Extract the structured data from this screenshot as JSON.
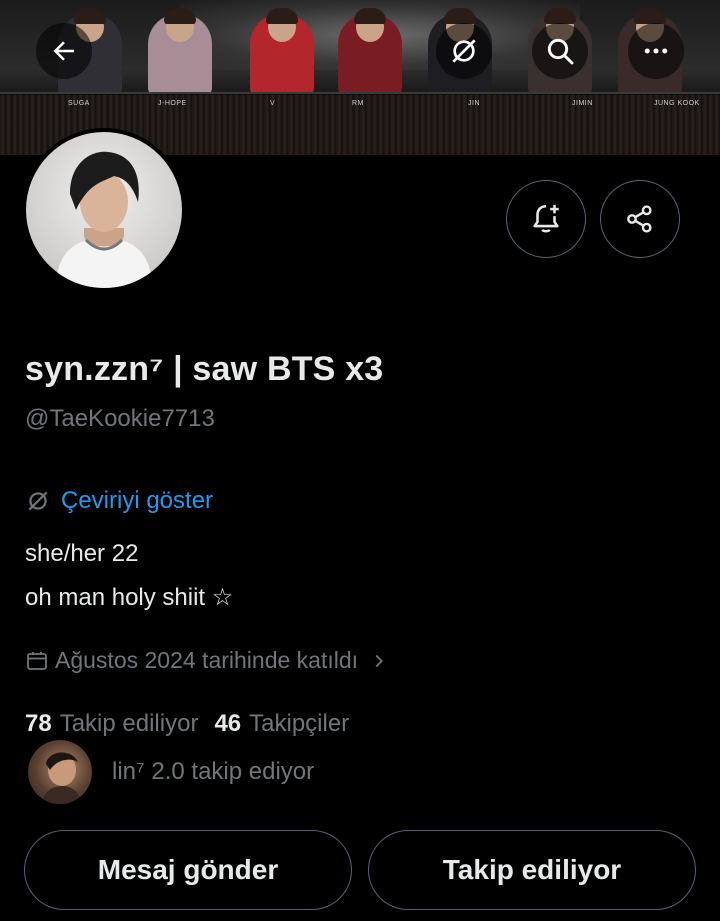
{
  "banner": {
    "name_tags": [
      "SUGA",
      "J-HOPE",
      "V",
      "RM",
      "JIN",
      "JIMIN",
      "JUNG KOOK"
    ]
  },
  "icons": {
    "back": "arrow-left-icon",
    "translate": "translate-icon",
    "search": "search-icon",
    "more": "more-horizontal-icon",
    "notify": "bell-plus-icon",
    "share": "share-icon",
    "calendar": "calendar-icon",
    "chevron": "chevron-right-icon"
  },
  "profile": {
    "display_name": "syn.zzn⁷ | saw BTS x3",
    "handle": "@TaeKookie7713",
    "translate_label": "Çeviriyi göster",
    "bio_lines": [
      "she/her 22",
      "oh man holy shiit ☆"
    ],
    "joined": "Ağustos 2024 tarihinde katıldı",
    "following_count": "78",
    "following_label": "Takip ediliyor",
    "followers_count": "46",
    "followers_label": "Takipçiler",
    "followed_by": "lin⁷ 2.0 takip ediyor"
  },
  "buttons": {
    "message": "Mesaj gönder",
    "following": "Takip ediliyor"
  },
  "colors": {
    "background": "#000000",
    "primary_text": "#e7e9ea",
    "secondary_text": "#71767b",
    "link": "#1d9bf0",
    "border": "#536471"
  }
}
